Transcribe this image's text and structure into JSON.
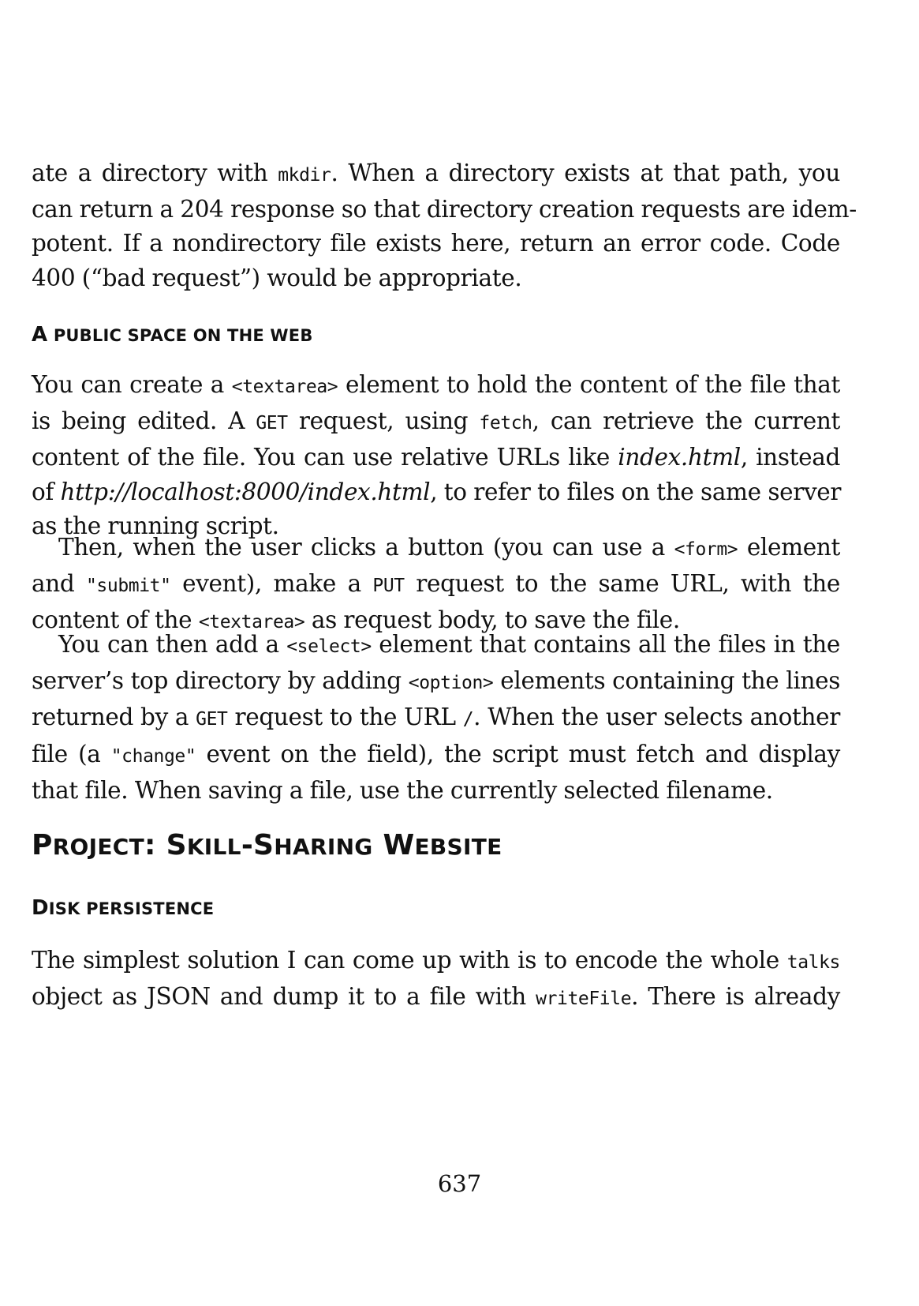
{
  "paragraphs": {
    "intro": {
      "l1_a": "ate a directory with ",
      "l1_code": "mkdir",
      "l1_b": ". When a directory exists at that path, you",
      "l2": "can return a 204 response so that directory creation requests are idem-",
      "l3": "potent. If a nondirectory file exists here, return an error code. Code",
      "l4": "400 (“bad request”) would be appropriate."
    },
    "public_1": {
      "l1_a": "You can create a ",
      "l1_code": "<textarea>",
      "l1_b": " element to hold the content of the file that",
      "l2_a": "is being edited. A ",
      "l2_code1": "GET",
      "l2_b": " request, using ",
      "l2_code2": "fetch",
      "l2_c": ", can retrieve the current",
      "l3_a": "content of the file. You can use relative URLs like ",
      "l3_em": "index.html",
      "l3_b": ", instead",
      "l4_a": "of ",
      "l4_em": "http://localhost:8000/index.html",
      "l4_b": ", to refer to files on the same server",
      "l5": "as the running script."
    },
    "public_2": {
      "l1_a": "Then, when the user clicks a button (you can use a ",
      "l1_code": "<form>",
      "l1_b": " element",
      "l2_a": "and ",
      "l2_code1": "\"submit\"",
      "l2_b": " event), make a ",
      "l2_code2": "PUT",
      "l2_c": " request to the same URL, with the",
      "l3_a": "content of the ",
      "l3_code": "<textarea>",
      "l3_b": " as request body, to save the file."
    },
    "public_3": {
      "l1_a": "You can then add a ",
      "l1_code": "<select>",
      "l1_b": " element that contains all the files in the",
      "l2_a": "server’s top directory by adding ",
      "l2_code": "<option>",
      "l2_b": " elements containing the lines",
      "l3_a": "returned by a ",
      "l3_code1": "GET",
      "l3_b": " request to the URL ",
      "l3_code2": "/",
      "l3_c": ". When the user selects another",
      "l4_a": "file (a ",
      "l4_code": "\"change\"",
      "l4_b": " event on the field), the script must fetch and display",
      "l5": "that file. When saving a file, use the currently selected filename."
    },
    "disk_1": {
      "l1_a": "The simplest solution I can come up with is to encode the whole ",
      "l1_code": "talks",
      "l2_a": "object as JSON and dump it to a file with ",
      "l2_code": "writeFile",
      "l2_b": ". There is already"
    }
  },
  "headings": {
    "public_space": {
      "big_a": "A",
      "small_a": " PUBLIC SPACE ON THE WEB"
    },
    "chapter": {
      "p1": "P",
      "p2": "ROJECT",
      "p3": ": S",
      "p4": "KILL",
      "p5": "-S",
      "p6": "HARING",
      "p7": " W",
      "p8": "EBSITE"
    },
    "disk": {
      "big_a": "D",
      "small_a": "ISK PERSISTENCE"
    }
  },
  "footer": {
    "page_number": "637"
  }
}
